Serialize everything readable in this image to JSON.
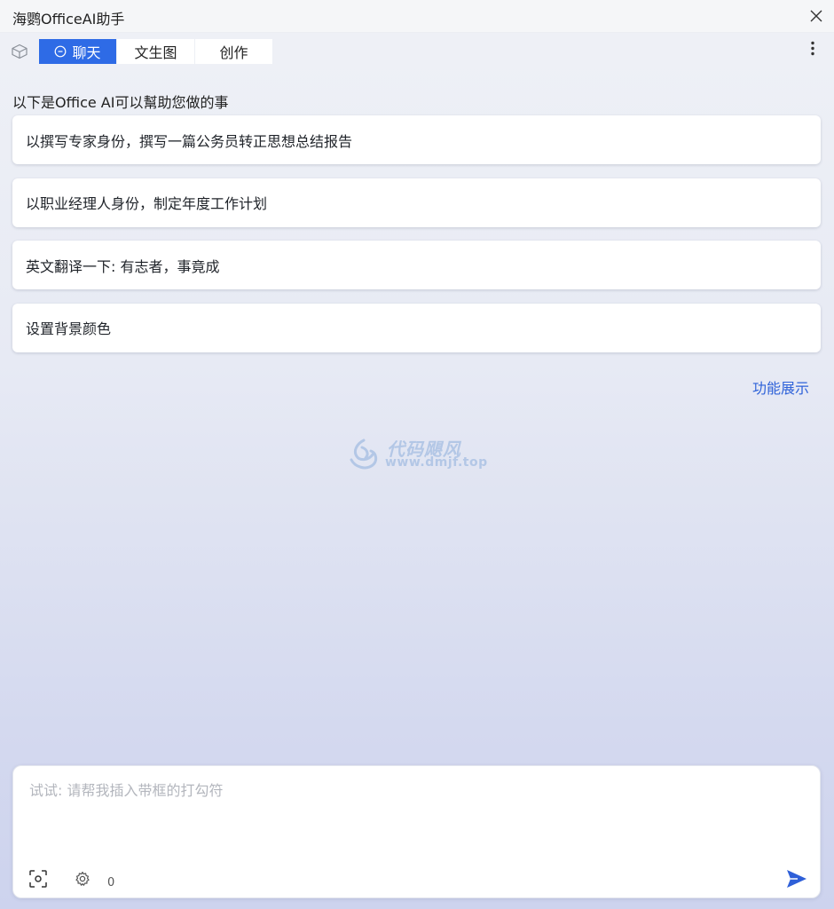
{
  "window": {
    "title": "海鹦OfficeAI助手"
  },
  "tabs": [
    {
      "label": "聊天",
      "active": true
    },
    {
      "label": "文生图",
      "active": false
    },
    {
      "label": "创作",
      "active": false
    }
  ],
  "intro": "以下是Office AI可以幫助您做的事",
  "suggestions": [
    "以撰写专家身份，撰写一篇公务员转正思想总结报告",
    "以职业经理人身份，制定年度工作计划",
    "英文翻译一下: 有志者，事竟成",
    "设置背景颜色"
  ],
  "feature_link": "功能展示",
  "watermark": {
    "title": "代码飓风",
    "url": "www.dmjf.top"
  },
  "input": {
    "placeholder": "试试: 请帮我插入带框的打勾符",
    "value": "",
    "char_count": "0"
  },
  "icons": {
    "close": "close-icon",
    "app": "cube-icon",
    "chat": "chat-bubble-icon",
    "more": "more-vertical-icon",
    "screenshot": "screenshot-icon",
    "settings": "gear-icon",
    "send": "send-icon"
  },
  "colors": {
    "accent": "#2e6be6",
    "link": "#2f62d9",
    "send": "#2e5fd8"
  }
}
